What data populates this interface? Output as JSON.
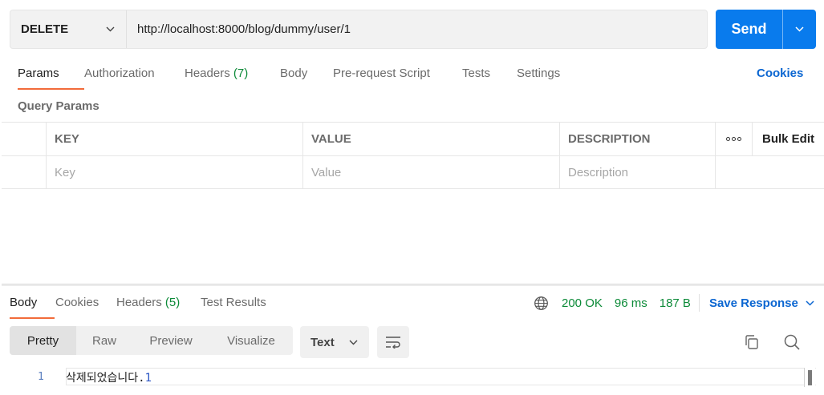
{
  "request": {
    "method": "DELETE",
    "url": "http://localhost:8000/blog/dummy/user/1",
    "send_label": "Send"
  },
  "request_tabs": [
    {
      "label": "Params",
      "active": true
    },
    {
      "label": "Authorization"
    },
    {
      "label": "Headers",
      "count": "(7)"
    },
    {
      "label": "Body"
    },
    {
      "label": "Pre-request Script"
    },
    {
      "label": "Tests"
    },
    {
      "label": "Settings"
    }
  ],
  "cookies_label": "Cookies",
  "query_params": {
    "title": "Query Params",
    "headers": {
      "key": "KEY",
      "value": "VALUE",
      "description": "DESCRIPTION",
      "bulk_edit": "Bulk Edit"
    },
    "placeholders": {
      "key": "Key",
      "value": "Value",
      "description": "Description"
    }
  },
  "response_tabs": [
    {
      "label": "Body",
      "active": true
    },
    {
      "label": "Cookies"
    },
    {
      "label": "Headers",
      "count": "(5)"
    },
    {
      "label": "Test Results"
    }
  ],
  "response_meta": {
    "status": "200 OK",
    "time": "96 ms",
    "size": "187 B",
    "save_label": "Save Response"
  },
  "view_modes": [
    "Pretty",
    "Raw",
    "Preview",
    "Visualize"
  ],
  "format": "Text",
  "body": {
    "line_number": "1",
    "text": "삭제되었습니다.",
    "number": "1"
  },
  "colors": {
    "accent": "#097bed",
    "tab_underline": "#f26b3a",
    "success": "#0c8a38",
    "link": "#0b66d1"
  }
}
